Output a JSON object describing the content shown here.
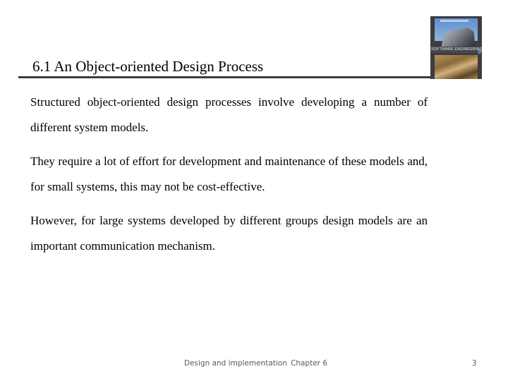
{
  "slide": {
    "title": "6.1 An Object-oriented Design Process",
    "paragraphs": [
      "Structured object-oriented design processes involve developing a number of different system models.",
      "They require a lot of effort for development and maintenance of these models and, for small systems, this may not be cost-effective.",
      "However, for large systems developed by different groups design models are an important communication mechanism."
    ],
    "cover_image": {
      "icon": "book-cover-image",
      "band_text": "SOFTWARE ENGINEERING",
      "edition": "9"
    },
    "footer": {
      "left": "Design and implementation",
      "middle": "Chapter 6",
      "page_number": "3"
    }
  }
}
